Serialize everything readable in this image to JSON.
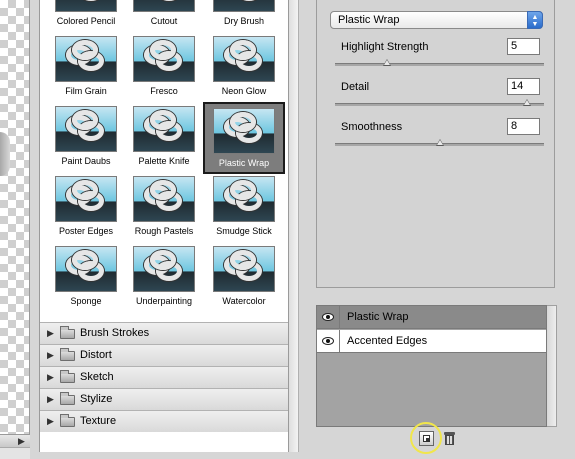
{
  "gallery": {
    "thumbnails": [
      {
        "label": "Colored Pencil"
      },
      {
        "label": "Cutout"
      },
      {
        "label": "Dry Brush"
      },
      {
        "label": "Film Grain"
      },
      {
        "label": "Fresco"
      },
      {
        "label": "Neon Glow"
      },
      {
        "label": "Paint Daubs"
      },
      {
        "label": "Palette Knife"
      },
      {
        "label": "Plastic Wrap",
        "selected": true
      },
      {
        "label": "Poster Edges"
      },
      {
        "label": "Rough Pastels"
      },
      {
        "label": "Smudge Stick"
      },
      {
        "label": "Sponge"
      },
      {
        "label": "Underpainting"
      },
      {
        "label": "Watercolor"
      }
    ],
    "categories": [
      {
        "label": "Brush Strokes"
      },
      {
        "label": "Distort"
      },
      {
        "label": "Sketch"
      },
      {
        "label": "Stylize"
      },
      {
        "label": "Texture"
      }
    ]
  },
  "settings": {
    "selected_filter": "Plastic Wrap",
    "params": [
      {
        "label": "Highlight Strength",
        "value": "5",
        "fraction": 0.25
      },
      {
        "label": "Detail",
        "value": "14",
        "fraction": 0.92
      },
      {
        "label": "Smoothness",
        "value": "8",
        "fraction": 0.5
      }
    ]
  },
  "layers": {
    "items": [
      {
        "name": "Plastic Wrap",
        "active": true
      },
      {
        "name": "Accented Edges",
        "active": false
      }
    ]
  },
  "icons": {
    "expand": "triangle-right-icon",
    "folder": "folder-icon",
    "visibility": "eye-icon",
    "dropdown": "up-down-arrows-icon",
    "new_layer": "new-effect-layer-icon",
    "delete_layer": "trash-icon"
  },
  "colors": {
    "selected_thumb_bg": "#7d7d7d",
    "active_layer_bg": "#8a8a8a",
    "select_arrow": "#2a6ccb",
    "highlight_ring": "#f1e64b"
  }
}
